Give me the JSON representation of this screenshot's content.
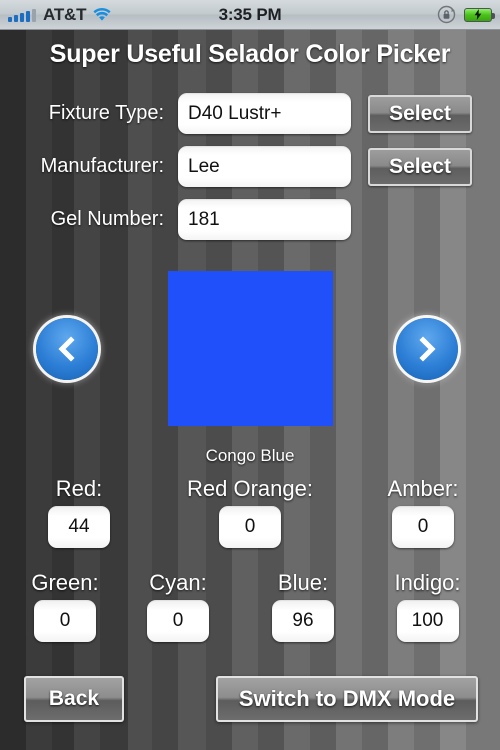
{
  "statusbar": {
    "carrier": "AT&T",
    "time": "3:35 PM",
    "signal_icon": "signal-bars-icon",
    "wifi_icon": "wifi-icon",
    "rotation_lock_icon": "rotation-lock-icon",
    "battery_icon": "battery-charging-icon",
    "battery_color": "#49c218"
  },
  "header": {
    "title": "Super Useful Selador Color Picker"
  },
  "form": {
    "rows": [
      {
        "label": "Fixture Type:",
        "value": "D40 Lustr+",
        "button": "Select",
        "has_button": true
      },
      {
        "label": "Manufacturer:",
        "value": "Lee",
        "button": "Select",
        "has_button": true
      },
      {
        "label": "Gel Number:",
        "value": "181",
        "button": "",
        "has_button": false
      }
    ]
  },
  "swatch": {
    "color": "#2050FA",
    "name": "Congo Blue",
    "prev_icon": "chevron-left-icon",
    "next_icon": "chevron-right-icon",
    "arrow_color": "#2d7fd6"
  },
  "channels": {
    "row1": [
      {
        "label": "Red:",
        "value": "44"
      },
      {
        "label": "Red Orange:",
        "value": "0"
      },
      {
        "label": "Amber:",
        "value": "0"
      }
    ],
    "row2": [
      {
        "label": "Green:",
        "value": "0"
      },
      {
        "label": "Cyan:",
        "value": "0"
      },
      {
        "label": "Blue:",
        "value": "96"
      },
      {
        "label": "Indigo:",
        "value": "100"
      }
    ]
  },
  "footer": {
    "back_label": "Back",
    "dmx_label": "Switch to DMX Mode"
  }
}
